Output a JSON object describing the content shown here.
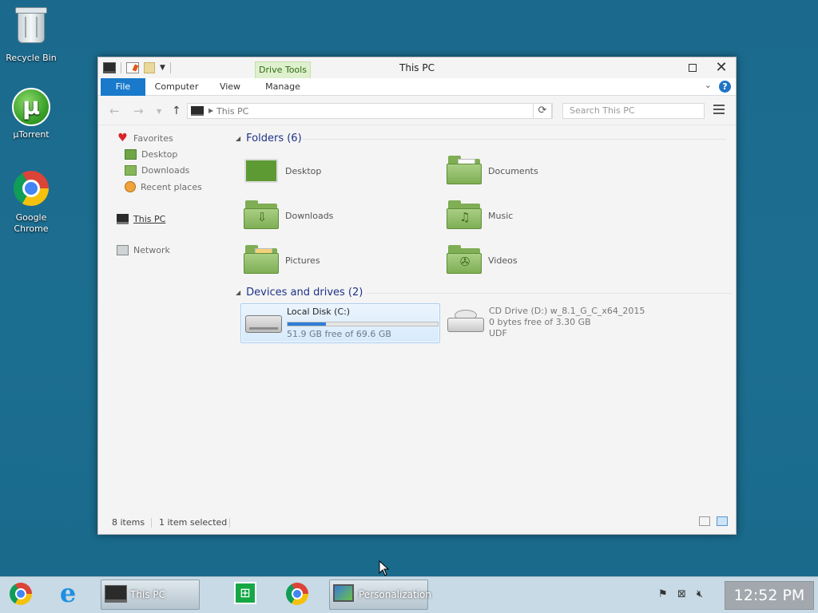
{
  "desktop": {
    "icons": [
      {
        "label": "Recycle Bin"
      },
      {
        "label": "µTorrent"
      },
      {
        "label": "Google Chrome"
      }
    ]
  },
  "window": {
    "title": "This PC",
    "contextual_tab": "Drive Tools",
    "tabs": [
      "File",
      "Computer",
      "View",
      "Manage"
    ],
    "help_label": "?"
  },
  "address": {
    "crumb": "This PC",
    "search_placeholder": "Search This PC"
  },
  "navpane": {
    "favorites": "Favorites",
    "desktop": "Desktop",
    "downloads": "Downloads",
    "recent": "Recent places",
    "thispc": "This PC",
    "network": "Network"
  },
  "folders": {
    "header": "Folders (6)",
    "items": [
      {
        "label": "Desktop"
      },
      {
        "label": "Documents"
      },
      {
        "label": "Downloads"
      },
      {
        "label": "Music"
      },
      {
        "label": "Pictures"
      },
      {
        "label": "Videos"
      }
    ]
  },
  "drives": {
    "header": "Devices and drives (2)",
    "items": [
      {
        "name": "Local Disk (C:)",
        "detail": "51.9 GB free of 69.6 GB",
        "used_fraction": 0.254,
        "selected": true
      },
      {
        "name": "CD Drive (D:) w_8.1_G_C_x64_2015",
        "detail": "0 bytes free of 3.30 GB",
        "fs": "UDF"
      }
    ]
  },
  "status": {
    "items": "8 items",
    "selected": "1 item selected"
  },
  "taskbar": {
    "this_pc": "This PC",
    "personalization": "Personalization",
    "clock": "12:52 PM"
  },
  "colors": {
    "desktop_bg": "#1b6a8e",
    "accent_file_tab": "#1979ca",
    "folder_green": "#7fae55",
    "header_blue": "#1e3287",
    "drive_bar": "#2f7ed8"
  }
}
